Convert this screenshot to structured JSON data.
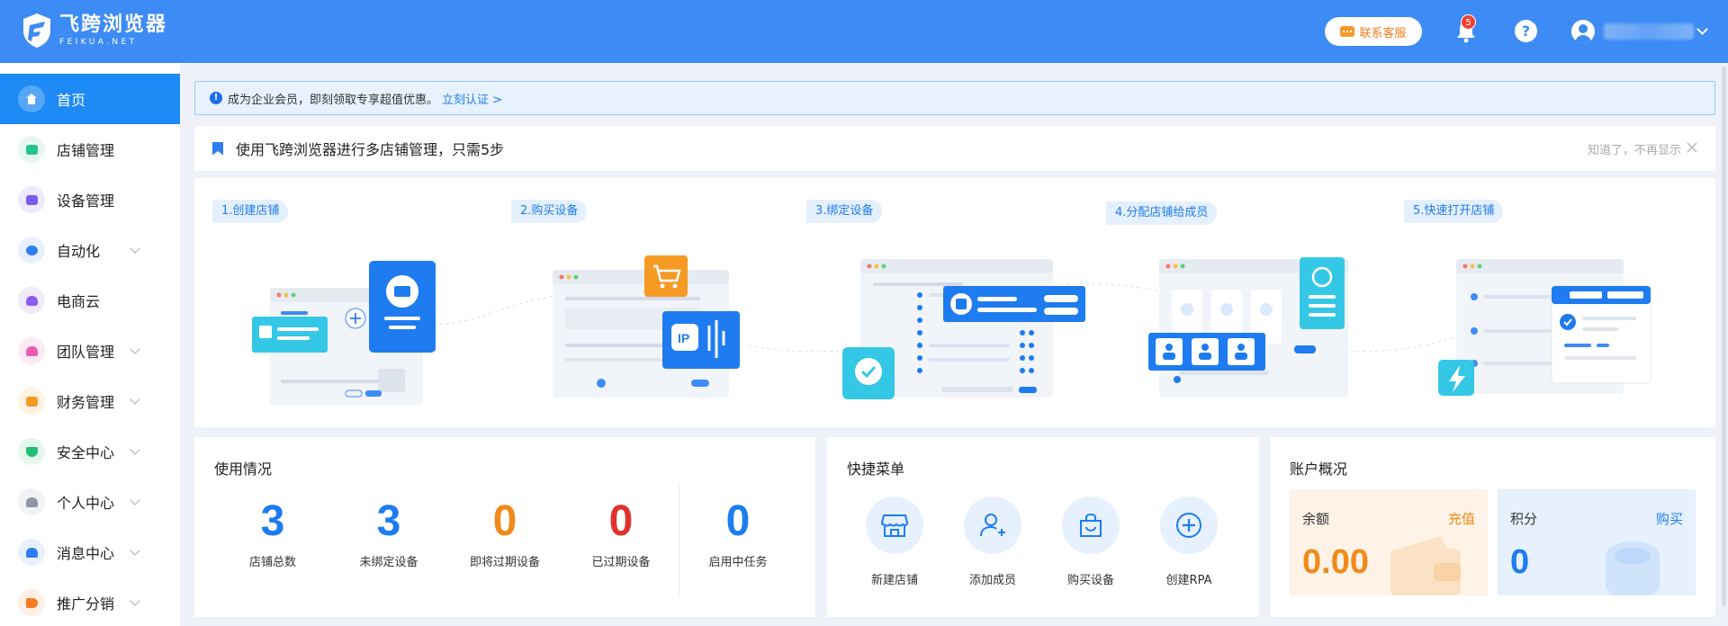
{
  "brand": {
    "name_cn": "飞跨浏览器",
    "name_en": "FEIKUA.NET"
  },
  "header": {
    "customer_service": "联系客服",
    "notification_count": "5",
    "help": "?"
  },
  "sidebar": {
    "items": [
      {
        "label": "首页",
        "icon": "home-icon",
        "color": "#ffffff",
        "expandable": false
      },
      {
        "label": "店铺管理",
        "icon": "store-icon",
        "color": "#22c48a",
        "expandable": false
      },
      {
        "label": "设备管理",
        "icon": "device-icon",
        "color": "#7b5cf0",
        "expandable": false
      },
      {
        "label": "自动化",
        "icon": "robot-icon",
        "color": "#2f7df3",
        "expandable": true
      },
      {
        "label": "电商云",
        "icon": "cloud-shop-icon",
        "color": "#8a5cf0",
        "expandable": false
      },
      {
        "label": "团队管理",
        "icon": "team-icon",
        "color": "#ea5bb0",
        "expandable": true
      },
      {
        "label": "财务管理",
        "icon": "wallet-icon",
        "color": "#f59a23",
        "expandable": true
      },
      {
        "label": "安全中心",
        "icon": "shield-icon",
        "color": "#1fbf75",
        "expandable": true
      },
      {
        "label": "个人中心",
        "icon": "user-icon",
        "color": "#8f95a3",
        "expandable": true
      },
      {
        "label": "消息中心",
        "icon": "bell-icon",
        "color": "#2f7df3",
        "expandable": true
      },
      {
        "label": "推广分销",
        "icon": "megaphone-icon",
        "color": "#f57c23",
        "expandable": true
      }
    ]
  },
  "notice": {
    "text": "成为企业会员，即刻领取专享超值优惠。",
    "link": "立刻认证 >"
  },
  "guide": {
    "title": "使用飞跨浏览器进行多店铺管理，只需5步",
    "dismiss": "知道了，不再显示",
    "steps": [
      {
        "label": "1.创建店铺"
      },
      {
        "label": "2.购买设备"
      },
      {
        "label": "3.绑定设备"
      },
      {
        "label": "4.分配店铺给成员"
      },
      {
        "label": "5.快速打开店铺"
      }
    ]
  },
  "usage": {
    "title": "使用情况",
    "stats": [
      {
        "value": "3",
        "label": "店铺总数",
        "color": "#1e7cf0"
      },
      {
        "value": "3",
        "label": "未绑定设备",
        "color": "#1e7cf0"
      },
      {
        "value": "0",
        "label": "即将过期设备",
        "color": "#f08a1c"
      },
      {
        "value": "0",
        "label": "已过期设备",
        "color": "#e0322c"
      },
      {
        "value": "0",
        "label": "启用中任务",
        "color": "#1e7cf0"
      }
    ]
  },
  "quick_menu": {
    "title": "快捷菜单",
    "items": [
      {
        "label": "新建店铺",
        "icon": "new-store-icon"
      },
      {
        "label": "添加成员",
        "icon": "add-member-icon"
      },
      {
        "label": "购买设备",
        "icon": "buy-device-icon"
      },
      {
        "label": "创建RPA",
        "icon": "create-rpa-icon"
      }
    ]
  },
  "account": {
    "title": "账户概况",
    "balance": {
      "label": "余额",
      "action": "充值",
      "value": "0.00"
    },
    "points": {
      "label": "积分",
      "action": "购买",
      "value": "0"
    }
  }
}
